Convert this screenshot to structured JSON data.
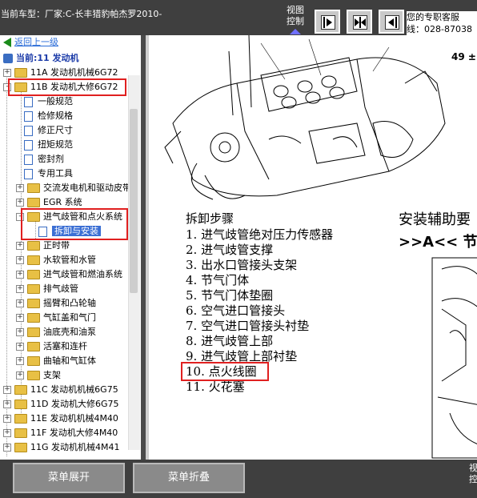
{
  "header": {
    "vehicle_label": "当前车型：厂家:C-长丰猎豹帕杰罗2010-",
    "view_control": [
      "视图",
      "控制"
    ],
    "contact": [
      "您的专职客服",
      "线：028-87038"
    ]
  },
  "tree": {
    "back_link": "返回上一级",
    "current": "当前:11 发动机",
    "items": [
      {
        "label": "11A 发动机机械6G72",
        "type": "folder",
        "expander": "+"
      },
      {
        "label": "11B 发动机大修6G72",
        "type": "folder",
        "expander": "-"
      },
      {
        "label": "一般规范",
        "type": "doc"
      },
      {
        "label": "检修规格",
        "type": "doc"
      },
      {
        "label": "修正尺寸",
        "type": "doc"
      },
      {
        "label": "扭矩规范",
        "type": "doc"
      },
      {
        "label": "密封剂",
        "type": "doc"
      },
      {
        "label": "专用工具",
        "type": "doc"
      },
      {
        "label": "交流发电机和驱动皮带",
        "type": "folder",
        "expander": "+"
      },
      {
        "label": "EGR 系统",
        "type": "folder",
        "expander": "+"
      },
      {
        "label": "进气歧管和点火系统",
        "type": "folder",
        "expander": "-"
      },
      {
        "label": "拆卸与安装",
        "type": "doc",
        "selected": true
      },
      {
        "label": "正时带",
        "type": "folder",
        "expander": "+"
      },
      {
        "label": "水软管和水管",
        "type": "folder",
        "expander": "+"
      },
      {
        "label": "进气歧管和燃油系统",
        "type": "folder",
        "expander": "+"
      },
      {
        "label": "排气歧管",
        "type": "folder",
        "expander": "+"
      },
      {
        "label": "摇臂和凸轮轴",
        "type": "folder",
        "expander": "+"
      },
      {
        "label": "气缸盖和气门",
        "type": "folder",
        "expander": "+"
      },
      {
        "label": "油底壳和油泵",
        "type": "folder",
        "expander": "+"
      },
      {
        "label": "活塞和连杆",
        "type": "folder",
        "expander": "+"
      },
      {
        "label": "曲轴和气缸体",
        "type": "folder",
        "expander": "+"
      },
      {
        "label": "支架",
        "type": "folder",
        "expander": "+"
      },
      {
        "label": "11C 发动机机械6G75",
        "type": "folder",
        "expander": "+"
      },
      {
        "label": "11D 发动机大修6G75",
        "type": "folder",
        "expander": "+"
      },
      {
        "label": "11E 发动机机械4M40",
        "type": "folder",
        "expander": "+"
      },
      {
        "label": "11F 发动机大修4M40",
        "type": "folder",
        "expander": "+"
      },
      {
        "label": "11G 发动机机械4M41",
        "type": "folder",
        "expander": "+"
      }
    ]
  },
  "document": {
    "part_note": "49 ±",
    "steps_title": "拆卸步骤",
    "steps": [
      "1.  进气歧管绝对压力传感器",
      "2.  进气歧管支撑",
      "3.  出水口管接头支架",
      "4.  节气门体",
      "5.  节气门体垫圈",
      "6.  空气进口管接头",
      "7.  空气进口管接头衬垫",
      "8.  进气歧管上部",
      "9.  进气歧管上部衬垫",
      "10. 点火线圈",
      "11. 火花塞"
    ],
    "aux_title": "安装辅助要",
    "aux_sub": ">>A<< 节"
  },
  "footer": {
    "expand_label": "菜单展开",
    "collapse_label": "菜单折叠",
    "right_text": [
      "视",
      "控"
    ]
  }
}
